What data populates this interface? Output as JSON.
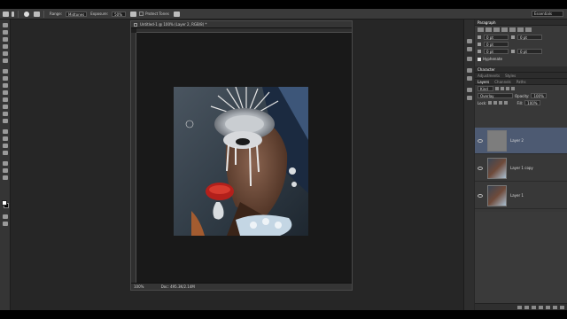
{
  "options_bar": {
    "range_label": "Range:",
    "range_value": "Midtones",
    "exposure_label": "Exposure:",
    "exposure_value": "50%",
    "protect_tones_label": "Protect Tones",
    "workspace": "Essentials"
  },
  "document": {
    "tab_title": "Untitled-1 @ 100% (Layer 2, RGB/8) *",
    "zoom": "100%",
    "doc_size": "Doc: 495.3K/2.14M"
  },
  "panels": {
    "paragraph_tab": "Paragraph",
    "para_fields": [
      "0 pt",
      "0 pt",
      "0 pt",
      "0 pt",
      "0 pt"
    ],
    "hyphenate_label": "Hyphenate",
    "character_tab": "Character",
    "adjustments_tab": "Adjustments",
    "styles_tab": "Styles",
    "layers_tab": "Layers",
    "channels_tab": "Channels",
    "paths_tab": "Paths",
    "kind_label": "Kind",
    "blend_mode": "Overlay",
    "opacity_label": "Opacity:",
    "opacity_value": "100%",
    "lock_label": "Lock:",
    "fill_label": "Fill:",
    "fill_value": "100%"
  },
  "layers": [
    {
      "name": "Layer 2",
      "selected": true
    },
    {
      "name": "Layer 1 copy",
      "selected": false
    },
    {
      "name": "Layer 1",
      "selected": false
    }
  ],
  "colors": {
    "selection": "#4d5a72",
    "panel_bg": "#383838",
    "app_bg": "#262626"
  }
}
